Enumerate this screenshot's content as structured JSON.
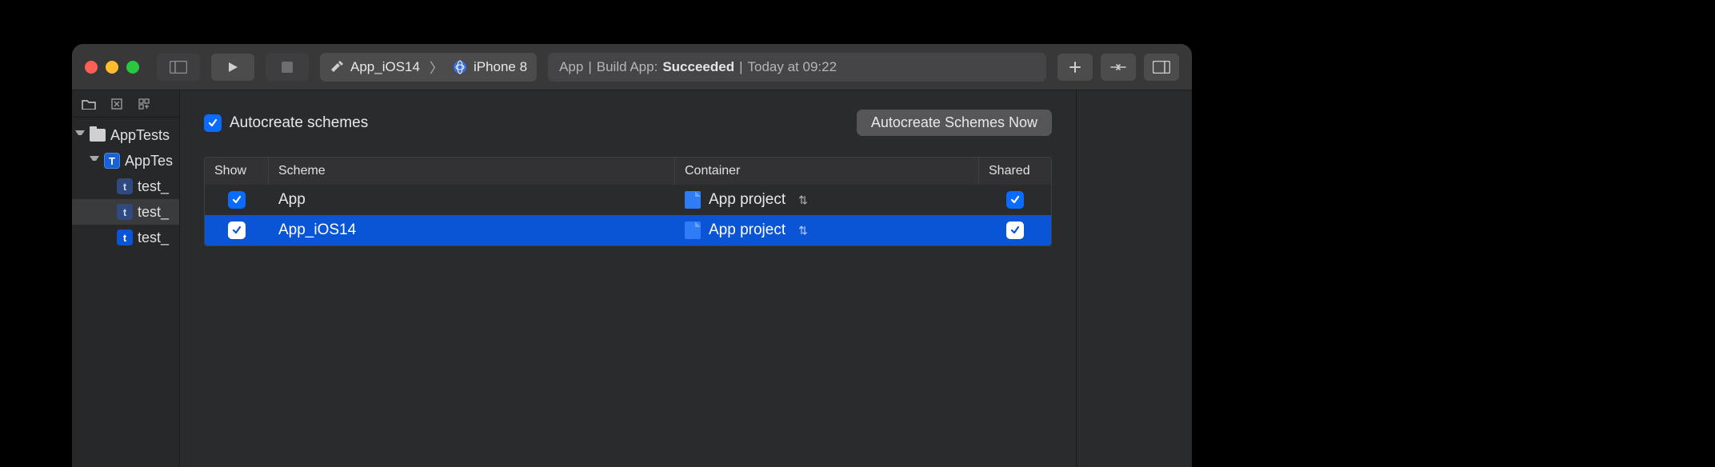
{
  "toolbar": {
    "scheme": "App_iOS14",
    "device": "iPhone 8",
    "activity_app": "App",
    "activity_action": "Build App:",
    "activity_status": "Succeeded",
    "activity_time": "Today at 09:22"
  },
  "sidebar": {
    "root": "AppTests",
    "group": "AppTes",
    "items": [
      "test_",
      "test_",
      "test_"
    ]
  },
  "schemes_panel": {
    "autocreate_label": "Autocreate schemes",
    "autocreate_button": "Autocreate Schemes Now",
    "columns": {
      "show": "Show",
      "scheme": "Scheme",
      "container": "Container",
      "shared": "Shared"
    },
    "rows": [
      {
        "scheme": "App",
        "container": "App project",
        "show": true,
        "shared": true,
        "selected": false
      },
      {
        "scheme": "App_iOS14",
        "container": "App project",
        "show": true,
        "shared": true,
        "selected": true
      }
    ]
  }
}
